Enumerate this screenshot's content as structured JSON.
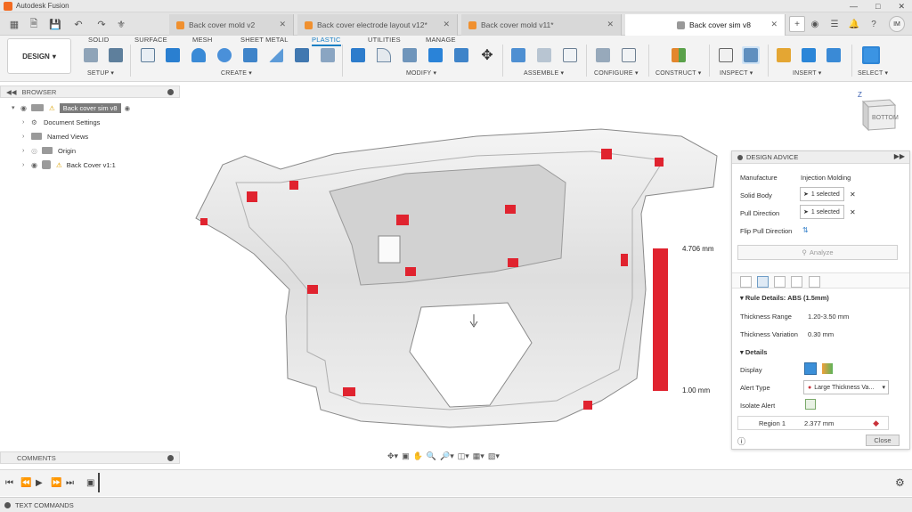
{
  "app": {
    "title": "Autodesk Fusion"
  },
  "tabs": [
    {
      "label": "Back cover mold v2"
    },
    {
      "label": "Back cover electrode layout v12*"
    },
    {
      "label": "Back cover mold v11*"
    },
    {
      "label": "Back cover sim v8"
    }
  ],
  "user": {
    "initials": "IM"
  },
  "workspace": {
    "label": "DESIGN"
  },
  "ribbon_tabs": [
    "SOLID",
    "SURFACE",
    "MESH",
    "SHEET METAL",
    "PLASTIC",
    "UTILITIES",
    "MANAGE"
  ],
  "ribbon_groups": [
    "SETUP",
    "CREATE",
    "MODIFY",
    "ASSEMBLE",
    "CONFIGURE",
    "CONSTRUCT",
    "INSPECT",
    "INSERT",
    "SELECT"
  ],
  "browser": {
    "title": "BROWSER",
    "root": "Back cover sim v8",
    "items": [
      "Document Settings",
      "Named Views",
      "Origin",
      "Back Cover v1:1"
    ]
  },
  "comments": {
    "label": "COMMENTS"
  },
  "thickness": {
    "max_label": "4.706 mm",
    "min_label": "1.00 mm",
    "bar_color": "#e0232f"
  },
  "advice": {
    "title": "DESIGN ADVICE",
    "manufacture_label": "Manufacture",
    "manufacture_value": "Injection Molding",
    "solid_body_label": "Solid Body",
    "solid_body_value": "1 selected",
    "pull_direction_label": "Pull Direction",
    "pull_direction_value": "1 selected",
    "flip_label": "Flip Pull Direction",
    "analyze_label": "Analyze",
    "rule_details": "Rule Details: ABS (1.5mm)",
    "thickness_range_label": "Thickness Range",
    "thickness_range_value": "1.20-3.50 mm",
    "thickness_variation_label": "Thickness Variation",
    "thickness_variation_value": "0.30 mm",
    "details_label": "Details",
    "display_label": "Display",
    "alert_type_label": "Alert Type",
    "alert_type_value": "Large Thickness Va...",
    "isolate_alert_label": "Isolate Alert",
    "region_label": "Region 1",
    "region_value": "2.377 mm",
    "close_label": "Close"
  },
  "viewcube": {
    "face": "BOTTOM",
    "axis": "Z"
  },
  "text_commands": {
    "label": "TEXT COMMANDS"
  }
}
